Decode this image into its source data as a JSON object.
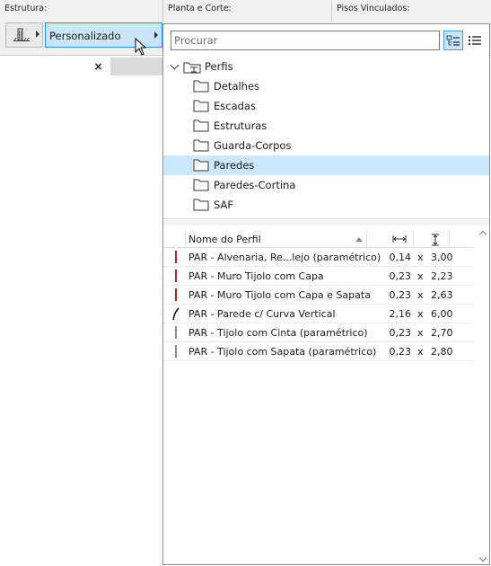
{
  "top": {
    "estrutura_label": "Estrutura:",
    "planta_label": "Planta e Corte:",
    "pisos_label": "Pisos Vinculados:",
    "personalizado": "Personalizado"
  },
  "left_tab": {
    "close": "×"
  },
  "search": {
    "placeholder": "Procurar"
  },
  "tree": {
    "root": "Perfis",
    "folders": [
      "Detalhes",
      "Escadas",
      "Estruturas",
      "Guarda-Corpos",
      "Paredes",
      "Paredes-Cortina",
      "SAF"
    ],
    "selected": "Paredes"
  },
  "table": {
    "header_name": "Nome do Perfil",
    "header_width_icon": "width-icon",
    "header_height_icon": "height-icon",
    "rows": [
      {
        "name": "PAR - Alvenaria, Re...lejo (paramétrico)",
        "w": "0,14",
        "x": "x",
        "h": "3,00",
        "color": "#b2232d",
        "shape": "bar"
      },
      {
        "name": "PAR - Muro Tijolo com Capa",
        "w": "0,23",
        "x": "x",
        "h": "2,23",
        "color": "#b2232d",
        "shape": "bar"
      },
      {
        "name": "PAR - Muro Tijolo com Capa e Sapata",
        "w": "0,23",
        "x": "x",
        "h": "2,63",
        "color": "#b2232d",
        "shape": "bar"
      },
      {
        "name": "PAR - Parede c/ Curva Vertical",
        "w": "2,16",
        "x": "x",
        "h": "6,00",
        "color": "#111111",
        "shape": "curve"
      },
      {
        "name": "PAR - Tijolo com Cinta (paramétrico)",
        "w": "0,23",
        "x": "x",
        "h": "2,70",
        "color": "#8a8a8a",
        "shape": "bar"
      },
      {
        "name": "PAR - Tijolo com Sapata (paramétrico)",
        "w": "0,23",
        "x": "x",
        "h": "2,80",
        "color": "#8a8a8a",
        "shape": "bar"
      }
    ]
  },
  "colors": {
    "selection": "#cce8ff",
    "button_active": "#cce4f7",
    "accent_border": "#3c8ad6"
  }
}
